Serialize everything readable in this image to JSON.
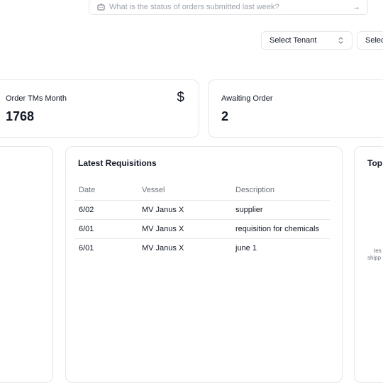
{
  "search": {
    "placeholder": "What is the status of orders submitted last week?",
    "submit_icon": "arrow-right-icon"
  },
  "filters": {
    "tenant_label": "Select Tenant",
    "second_label": "Selec"
  },
  "stats": [
    {
      "label": "Order TMs Month",
      "value": "1768",
      "icon": "dollar-icon"
    },
    {
      "label": "Awaiting Order",
      "value": "2"
    }
  ],
  "requisitions": {
    "title": "Latest Requisitions",
    "columns": [
      "Date",
      "Vessel",
      "Description"
    ],
    "rows": [
      [
        "6/02",
        "MV Janus X",
        "supplier"
      ],
      [
        "6/01",
        "MV Janus X",
        "requisition for chemicals"
      ],
      [
        "6/01",
        "MV Janus X",
        "june 1"
      ]
    ]
  },
  "right_panel": {
    "title": "Top",
    "line1": "tes",
    "line2": "shipp"
  }
}
